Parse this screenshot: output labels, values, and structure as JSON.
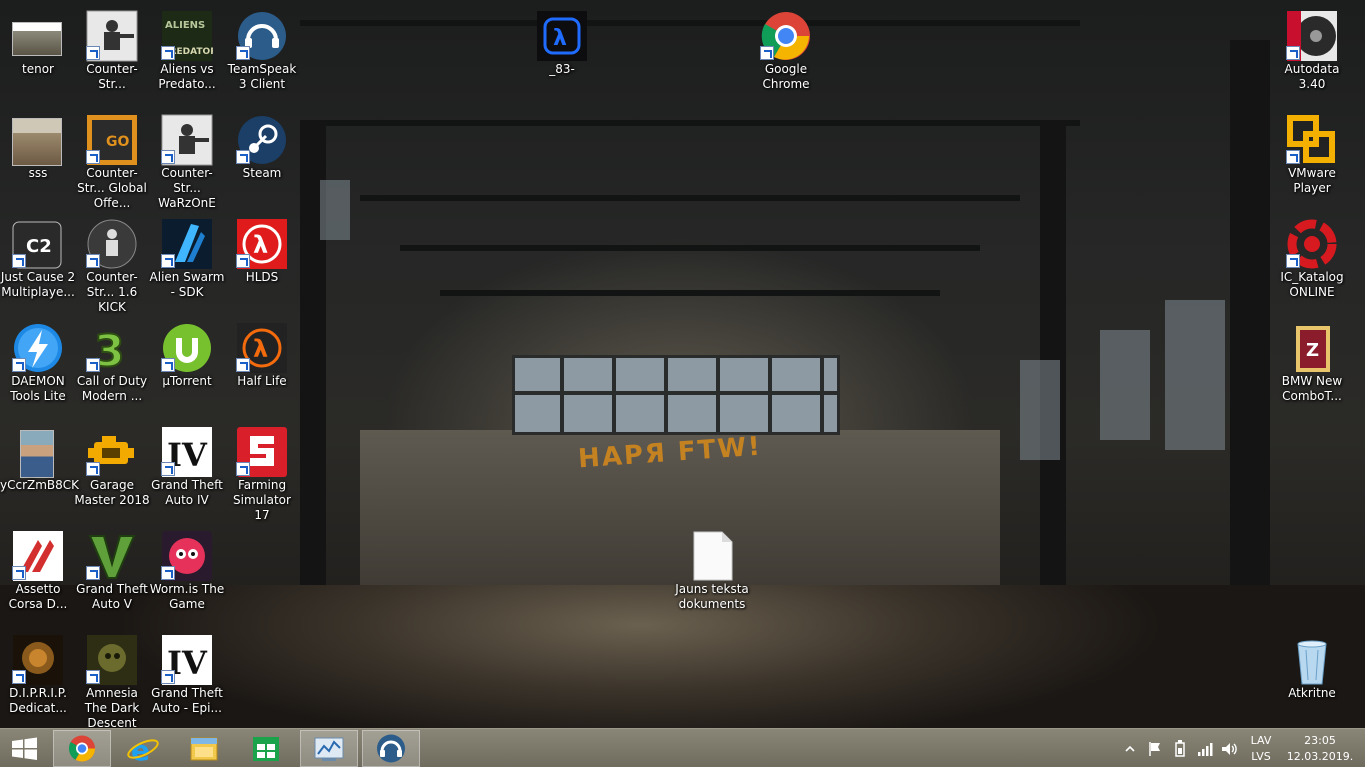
{
  "desktop": {
    "icons": [
      {
        "label": "tenor"
      },
      {
        "label": "sss"
      },
      {
        "label": "Just Cause 2 Multiplaye..."
      },
      {
        "label": "DAEMON Tools Lite"
      },
      {
        "label": "yCcrZmB8CK"
      },
      {
        "label": "Assetto Corsa D..."
      },
      {
        "label": "D.I.P.R.I.P. Dedicat..."
      },
      {
        "label": "Counter-Str..."
      },
      {
        "label": "Counter-Str... Global Offe..."
      },
      {
        "label": "Counter-Str... 1.6 KICK"
      },
      {
        "label": "Call of Duty Modern ..."
      },
      {
        "label": "Garage Master 2018"
      },
      {
        "label": "Grand Theft Auto V"
      },
      {
        "label": "Amnesia The Dark Descent"
      },
      {
        "label": "Aliens vs Predato..."
      },
      {
        "label": "Counter-Str... WaRzOnE"
      },
      {
        "label": "Alien Swarm - SDK"
      },
      {
        "label": "µTorrent"
      },
      {
        "label": "Grand Theft Auto IV"
      },
      {
        "label": "Worm.is The Game"
      },
      {
        "label": "Grand Theft Auto - Epi..."
      },
      {
        "label": "TeamSpeak 3 Client"
      },
      {
        "label": "Steam"
      },
      {
        "label": "HLDS"
      },
      {
        "label": "Half Life"
      },
      {
        "label": "Farming Simulator 17"
      },
      {
        "label": "_83-"
      },
      {
        "label": "Google Chrome"
      },
      {
        "label": "Jauns teksta dokuments"
      },
      {
        "label": "Autodata 3.40"
      },
      {
        "label": "VMware Player"
      },
      {
        "label": "IC_Katalog ONLINE"
      },
      {
        "label": "BMW New ComboT..."
      },
      {
        "label": "Atkritne"
      }
    ],
    "wallpaper_graffiti": "НАРЯ FTW!"
  },
  "taskbar": {
    "start": {
      "icon": "windows-logo-icon"
    },
    "pinned": [
      {
        "name": "Google Chrome",
        "icon": "chrome-icon",
        "active": true
      },
      {
        "name": "Internet Explorer",
        "icon": "internet-explorer-icon",
        "active": false
      },
      {
        "name": "File Explorer",
        "icon": "file-explorer-icon",
        "active": false
      },
      {
        "name": "Store",
        "icon": "store-icon",
        "active": false
      },
      {
        "name": "Control Panel",
        "icon": "control-panel-icon",
        "active": true
      },
      {
        "name": "TeamSpeak 3 Client",
        "icon": "teamspeak-icon",
        "active": true
      }
    ],
    "tray": {
      "language_top": "LAV",
      "language_bottom": "LVS",
      "time": "23:05",
      "date": "12.03.2019."
    }
  },
  "colors": {
    "taskbar": "#7b7769",
    "label_text": "#ffffff",
    "graffiti": "#d88a1a"
  }
}
